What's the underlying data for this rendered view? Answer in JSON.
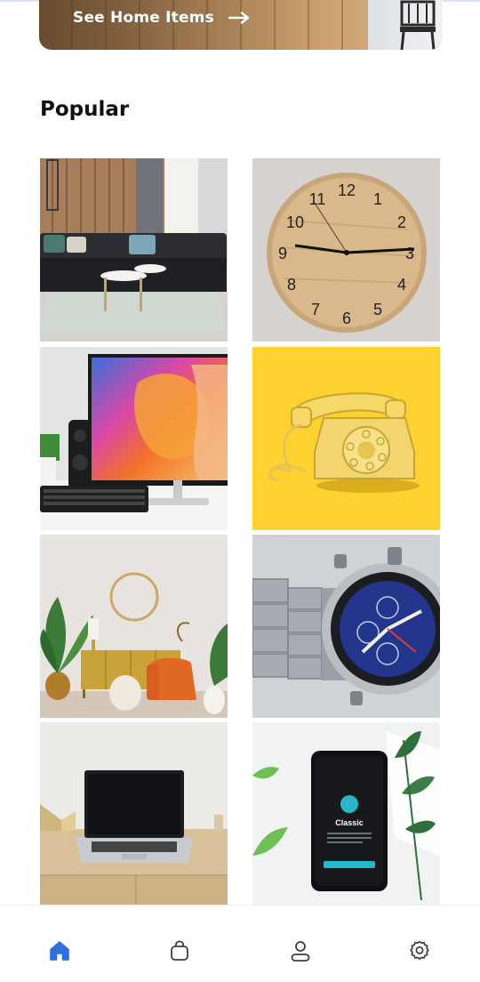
{
  "banner": {
    "cta_label": "See Home Items",
    "icon": "arrow-right-icon"
  },
  "section": {
    "title": "Popular"
  },
  "products": [
    {
      "name": "living-room-sofa"
    },
    {
      "name": "wall-clock"
    },
    {
      "name": "desktop-monitor"
    },
    {
      "name": "rotary-telephone"
    },
    {
      "name": "living-room-decor"
    },
    {
      "name": "wristwatch"
    },
    {
      "name": "laptop"
    },
    {
      "name": "smartphone"
    }
  ],
  "phone_screen": {
    "app_title": "Classic"
  },
  "clock_numbers": [
    "12",
    "1",
    "2",
    "3",
    "4",
    "5",
    "6",
    "7",
    "8",
    "9",
    "10",
    "11"
  ],
  "nav": [
    {
      "icon": "home-icon",
      "active": true
    },
    {
      "icon": "shopping-bag-icon",
      "active": false
    },
    {
      "icon": "user-icon",
      "active": false
    },
    {
      "icon": "settings-icon",
      "active": false
    }
  ],
  "colors": {
    "accent": "#2f6fde",
    "nav_inactive": "#3a3f47",
    "phone_bg": "#fdd12f"
  }
}
